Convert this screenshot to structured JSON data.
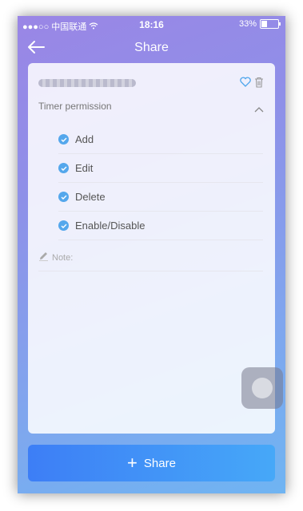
{
  "statusbar": {
    "signal": "●●●○○",
    "carrier": "中国联通",
    "time": "18:16",
    "battery": "33%",
    "battery_level": 0.33
  },
  "nav": {
    "title": "Share"
  },
  "card": {
    "permission_title": "Timer permission",
    "permissions": [
      "Add",
      "Edit",
      "Delete",
      "Enable/Disable"
    ],
    "note_label": "Note:",
    "note_value": ""
  },
  "share_button": {
    "label": "Share"
  },
  "colors": {
    "accent": "#54a7ec",
    "button_start": "#3d7ef6",
    "button_end": "#46a8f8"
  }
}
